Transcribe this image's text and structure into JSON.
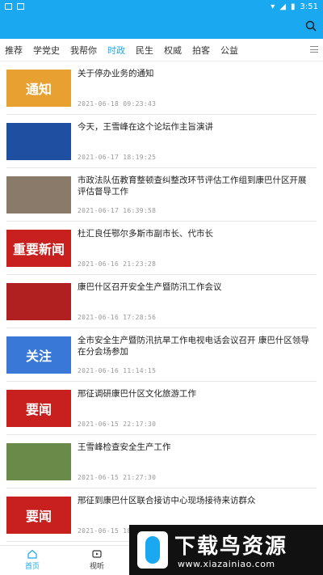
{
  "status": {
    "time": "3:51"
  },
  "tabs": [
    {
      "label": "推荐"
    },
    {
      "label": "学党史"
    },
    {
      "label": "我帮你"
    },
    {
      "label": "时政",
      "active": true
    },
    {
      "label": "民生"
    },
    {
      "label": "权威"
    },
    {
      "label": "拍客"
    },
    {
      "label": "公益"
    }
  ],
  "news": [
    {
      "title": "关于停办业务的通知",
      "date": "2021-06-18 09:23:43",
      "thumb_text": "通知",
      "thumb_color": "#e8a030"
    },
    {
      "title": "今天，王雪峰在这个论坛作主旨演讲",
      "date": "2021-06-17 18:19:25",
      "thumb_text": "",
      "thumb_color": "#1e4fa0"
    },
    {
      "title": "市政法队伍教育整顿查纠整改环节评估工作组到康巴什区开展评估督导工作",
      "date": "2021-06-17 16:39:58",
      "thumb_text": "",
      "thumb_color": "#8a7a6a"
    },
    {
      "title": "杜汇良任鄂尔多斯市副市长、代市长",
      "date": "2021-06-16 21:23:28",
      "thumb_text": "重要新闻",
      "thumb_color": "#c8201e"
    },
    {
      "title": "康巴什区召开安全生产暨防汛工作会议",
      "date": "2021-06-16 17:28:56",
      "thumb_text": "",
      "thumb_color": "#b02020"
    },
    {
      "title": "全市安全生产暨防汛抗旱工作电视电话会议召开 康巴什区领导在分会场参加",
      "date": "2021-06-16 11:14:15",
      "thumb_text": "关注",
      "thumb_color": "#3a78d8"
    },
    {
      "title": "邢征调研康巴什区文化旅游工作",
      "date": "2021-06-15 22:17:30",
      "thumb_text": "要闻",
      "thumb_color": "#c8201e"
    },
    {
      "title": "王雪峰检查安全生产工作",
      "date": "2021-06-15 21:27:30",
      "thumb_text": "",
      "thumb_color": "#6a8a4a"
    },
    {
      "title": "邢征到康巴什区联合接访中心现场接待来访群众",
      "date": "2021-06-15 18:",
      "thumb_text": "要闻",
      "thumb_color": "#c8201e"
    }
  ],
  "bottom_nav": [
    {
      "label": "首页",
      "active": true
    },
    {
      "label": "视听"
    }
  ],
  "watermark": {
    "title": "下载鸟资源",
    "url": "www.xiazainiao.com"
  }
}
